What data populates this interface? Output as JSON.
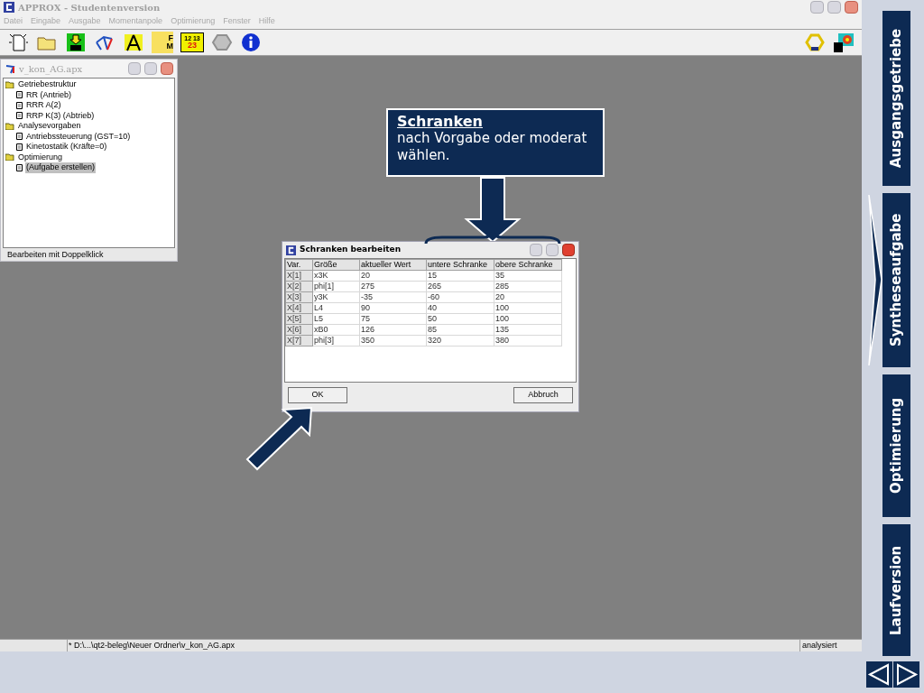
{
  "window": {
    "title": "APPROX - Studentenversion"
  },
  "menu": [
    "Datei",
    "Eingabe",
    "Ausgabe",
    "Momentanpole",
    "Optimierung",
    "Fenster",
    "Hilfe"
  ],
  "toolbar": [
    {
      "kind": "new"
    },
    {
      "kind": "open"
    },
    {
      "kind": "save"
    },
    {
      "kind": "mechanism"
    },
    {
      "kind": "compass"
    },
    {
      "kind": "force",
      "texts": [
        "F",
        "M"
      ]
    },
    {
      "kind": "numbers",
      "texts": [
        "12 13",
        "23"
      ]
    },
    {
      "kind": "hexagon"
    },
    {
      "kind": "info"
    }
  ],
  "toolbar_right": [
    {
      "kind": "optim"
    },
    {
      "kind": "plot"
    }
  ],
  "child_window": {
    "title": "v_kon_AG.apx",
    "tree": [
      {
        "label": "Getriebestruktur",
        "selected": false,
        "children": [
          {
            "label": "RR (Antrieb)",
            "selected": false
          },
          {
            "label": "RRR A(2)",
            "selected": false
          },
          {
            "label": "RRP K(3) (Abtrieb)",
            "selected": false
          }
        ]
      },
      {
        "label": "Analysevorgaben",
        "selected": false,
        "children": [
          {
            "label": "Antriebssteuerung (GST=10)",
            "selected": false
          },
          {
            "label": "Kinetostatik (Kräfte=0)",
            "selected": false
          }
        ]
      },
      {
        "label": "Optimierung",
        "selected": false,
        "children": [
          {
            "label": "(Aufgabe erstellen)",
            "selected": true
          }
        ]
      }
    ],
    "status": "Bearbeiten mit Doppelklick"
  },
  "callout": {
    "title": "Schranken",
    "text": "nach Vorgabe oder moderat wählen."
  },
  "dialog": {
    "title": "Schranken bearbeiten",
    "table": {
      "columns": [
        "Var.",
        "Größe",
        "aktueller Wert",
        "untere Schranke",
        "obere Schranke"
      ],
      "rows": [
        [
          "X[1]",
          "x3K",
          "20",
          "15",
          "35"
        ],
        [
          "X[2]",
          "phi[1]",
          "275",
          "265",
          "285"
        ],
        [
          "X[3]",
          "y3K",
          "-35",
          "-60",
          "20"
        ],
        [
          "X[4]",
          "L4",
          "90",
          "40",
          "100"
        ],
        [
          "X[5]",
          "L5",
          "75",
          "50",
          "100"
        ],
        [
          "X[6]",
          "xB0",
          "126",
          "85",
          "135"
        ],
        [
          "X[7]",
          "phi[3]",
          "350",
          "320",
          "380"
        ]
      ]
    },
    "buttons": [
      "OK",
      "Abbruch"
    ]
  },
  "status_bar": [
    "* D:\\...\\qt2-beleg\\Neuer Ordner\\v_kon_AG.apx",
    "analysiert"
  ],
  "nav_tabs": [
    {
      "label": "Ausgangsgetriebe",
      "selected": false
    },
    {
      "label": "Syntheseaufgabe",
      "selected": true
    },
    {
      "label": "Optimierung",
      "selected": false
    },
    {
      "label": "Laufversion",
      "selected": false
    }
  ]
}
